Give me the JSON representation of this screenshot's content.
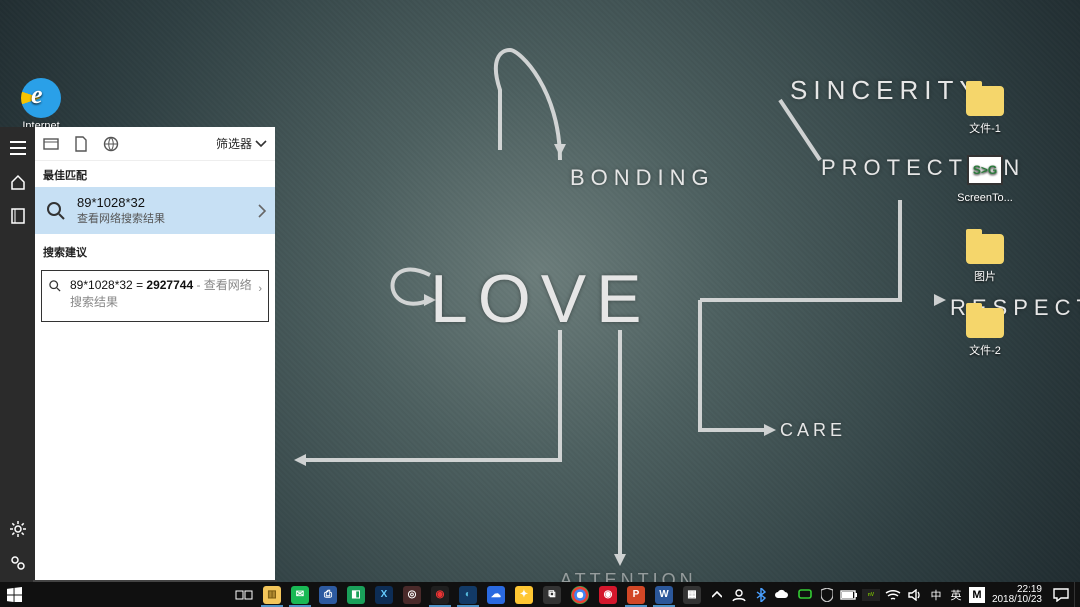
{
  "wallpaper": {
    "love": "LOVE",
    "bonding": "BONDING",
    "sincerity": "SINCERITY",
    "protection": "PROTECTION",
    "respect": "RESPECT",
    "care": "CARE",
    "attention": "ATTENTION"
  },
  "desktop_icons": {
    "ie": "Internet Explorer",
    "file1": "文件-1",
    "screentogif": "ScreenTo...",
    "pictures": "图片",
    "file2": "文件-2"
  },
  "cortana": {
    "filter_label": "筛选器",
    "best_match_header": "最佳匹配",
    "best_title": "89*1028*32",
    "best_sub": "查看网络搜索结果",
    "suggestions_header": "搜索建议",
    "sugg_prefix": "89*1028*32 = ",
    "sugg_result": "2927744",
    "sugg_tail": " - 查看网络搜索结果"
  },
  "search": {
    "value": "89*1028*32"
  },
  "tray": {
    "ime1": "中",
    "ime2": "英",
    "ime_m": "M"
  },
  "clock": {
    "time": "22:19",
    "date": "2018/10/23"
  },
  "colors": {
    "sel": "#c7e0f4",
    "taskbar": "#101010"
  },
  "stg_badge": "S>G"
}
